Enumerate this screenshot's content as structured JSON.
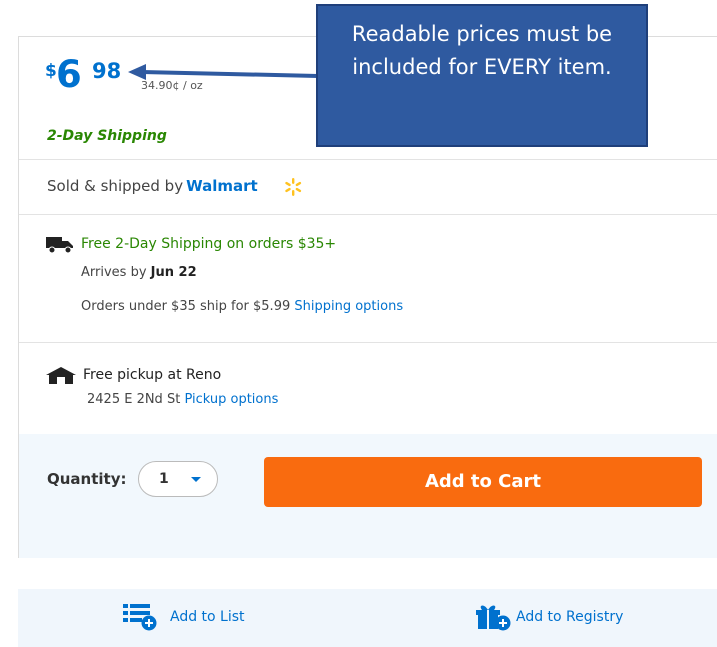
{
  "product": {
    "price_currency": "$",
    "price_dollars": "6",
    "price_cents": "98",
    "unit_price": "34.90¢ / oz",
    "shipping_tag": "2-Day Shipping"
  },
  "seller": {
    "prefix": "Sold & shipped by",
    "name": "Walmart"
  },
  "delivery": {
    "free_shipping": "Free 2-Day Shipping on orders $35+",
    "arrives_prefix": "Arrives by",
    "arrives_date": "Jun 22",
    "orders_under": "Orders under $35 ship for $5.99",
    "shipping_options_link": "Shipping options"
  },
  "pickup": {
    "title": "Free pickup at Reno",
    "address": "2425 E 2Nd St",
    "pickup_options_link": "Pickup options"
  },
  "purchase": {
    "quantity_label": "Quantity:",
    "quantity_value": "1",
    "add_to_cart": "Add to Cart"
  },
  "actions": {
    "add_to_list": "Add to List",
    "add_to_registry": "Add to Registry"
  },
  "annotation": {
    "text": "Readable prices must be included for EVERY item."
  },
  "colors": {
    "brand_blue": "#0071ce",
    "shipping_green": "#2a8703",
    "cart_orange": "#f96b0f",
    "callout_blue": "#2f5aa0"
  }
}
